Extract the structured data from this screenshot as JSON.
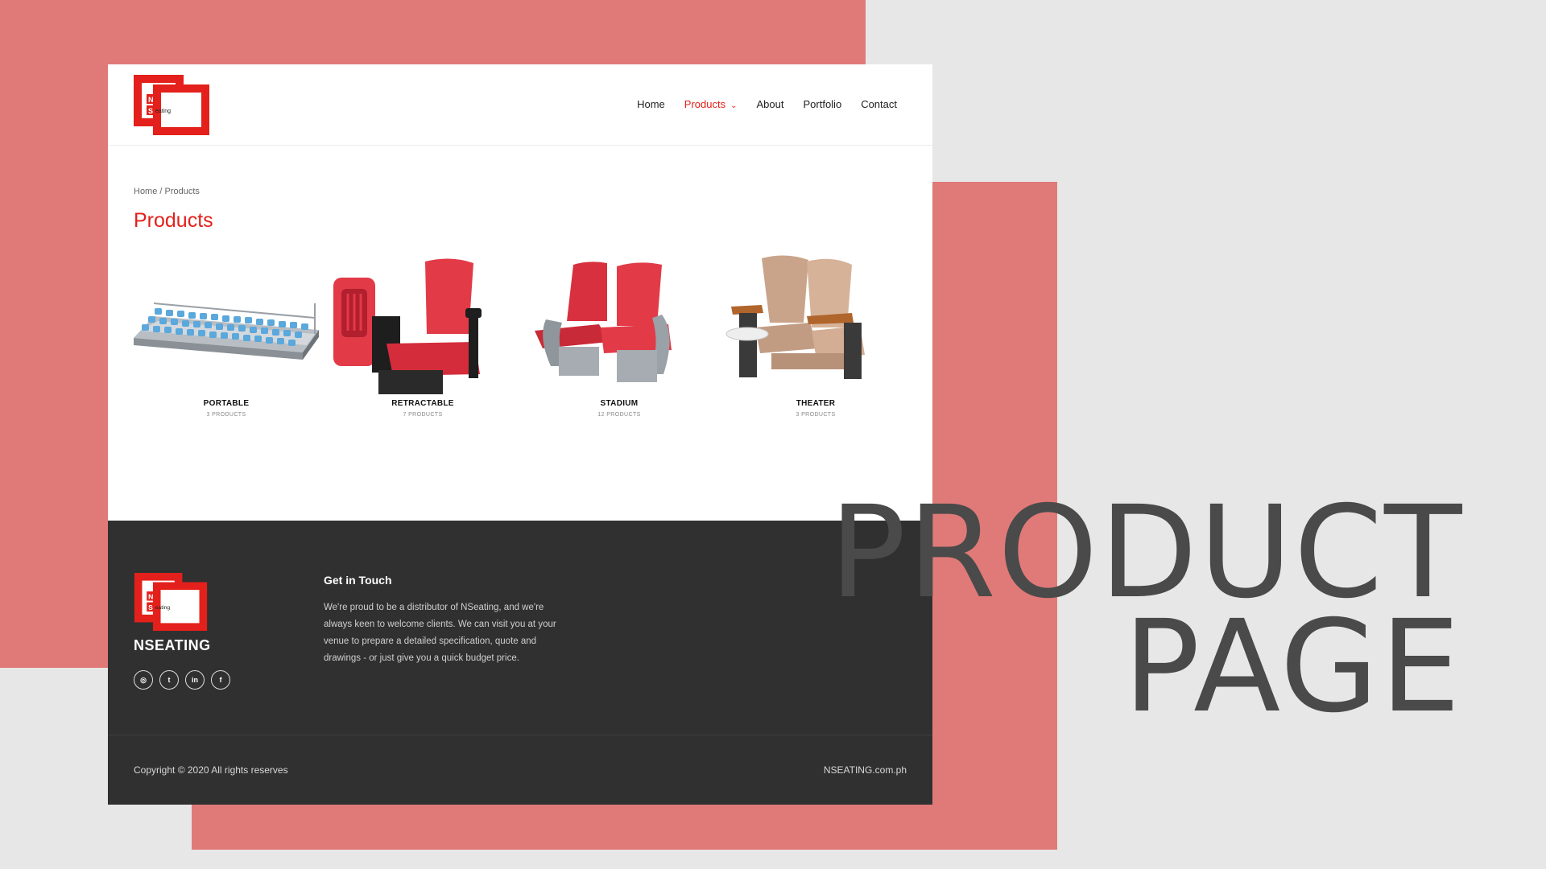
{
  "colors": {
    "accent": "#e3201b",
    "coral": "#e07a78",
    "background": "#e7e7e7",
    "footer": "#303030",
    "headline": "#4a4a4a"
  },
  "header": {
    "logo": {
      "letter_n": "N",
      "letter_s": "S",
      "word": "eating"
    },
    "nav": [
      {
        "label": "Home"
      },
      {
        "label": "Products",
        "active": true,
        "has_dropdown": true,
        "icon": "chevron-down-icon"
      },
      {
        "label": "About"
      },
      {
        "label": "Portfolio"
      },
      {
        "label": "Contact"
      }
    ]
  },
  "breadcrumb": "Home / Products",
  "page_title": "Products",
  "categories": [
    {
      "name": "PORTABLE",
      "count": "3 PRODUCTS",
      "image": "blue-bleacher-seating"
    },
    {
      "name": "RETRACTABLE",
      "count": "7 PRODUCTS",
      "image": "red-retractable-seat"
    },
    {
      "name": "STADIUM",
      "count": "12 PRODUCTS",
      "image": "red-stadium-seats"
    },
    {
      "name": "THEATER",
      "count": "3 PRODUCTS",
      "image": "beige-theater-seats"
    }
  ],
  "footer": {
    "brand": "NSEATING",
    "socials": [
      {
        "icon": "instagram-icon",
        "glyph": "◎"
      },
      {
        "icon": "twitter-icon",
        "glyph": "t"
      },
      {
        "icon": "linkedin-icon",
        "glyph": "in"
      },
      {
        "icon": "facebook-icon",
        "glyph": "f"
      }
    ],
    "get_in_touch_title": "Get in Touch",
    "get_in_touch_text": "We're proud to be a distributor of NSeating, and we're always keen to welcome clients. We can visit you at your venue to prepare a detailed specification, quote and drawings - or just give you a quick budget price.",
    "copyright": "Copyright © 2020 All rights reserves",
    "site": "NSEATING.com.ph"
  },
  "headline": {
    "line1": "PRODUCT",
    "line2": "PAGE"
  }
}
